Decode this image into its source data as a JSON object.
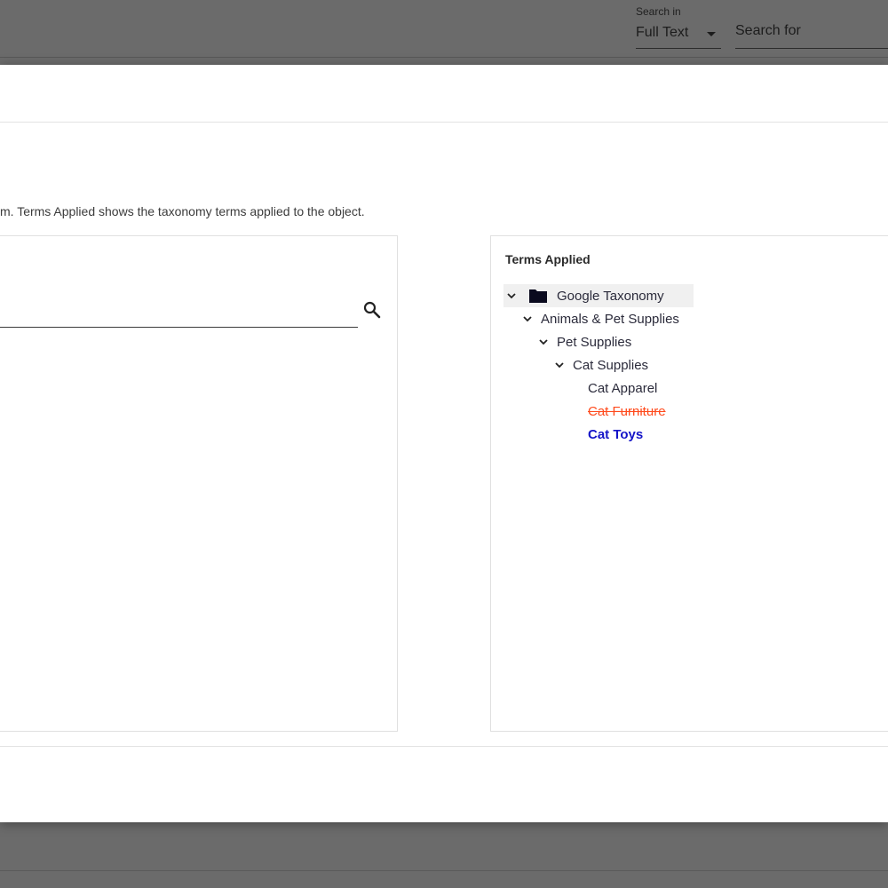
{
  "toolbar": {
    "search_in_label": "Search in",
    "search_in_value": "Full Text",
    "search_for_placeholder": "Search for"
  },
  "dialog": {
    "description": "m. Terms Applied shows the taxonomy terms applied to the object.",
    "term_search_placeholder": "",
    "terms_applied": {
      "title": "Terms Applied",
      "tree": [
        {
          "label": "Google Taxonomy",
          "level": 0,
          "expanded": true,
          "folder": true,
          "status": "normal"
        },
        {
          "label": "Animals & Pet Supplies",
          "level": 1,
          "expanded": true,
          "status": "normal"
        },
        {
          "label": "Pet Supplies",
          "level": 2,
          "expanded": true,
          "status": "normal"
        },
        {
          "label": "Cat Supplies",
          "level": 3,
          "expanded": true,
          "status": "normal"
        },
        {
          "label": "Cat Apparel",
          "level": 4,
          "status": "normal"
        },
        {
          "label": "Cat Furniture",
          "level": 4,
          "status": "removed"
        },
        {
          "label": "Cat Toys",
          "level": 4,
          "status": "added"
        }
      ]
    }
  },
  "colors": {
    "removed": "#ff4a1c",
    "added": "#1414c8",
    "overlay": "#6b6b6b"
  }
}
